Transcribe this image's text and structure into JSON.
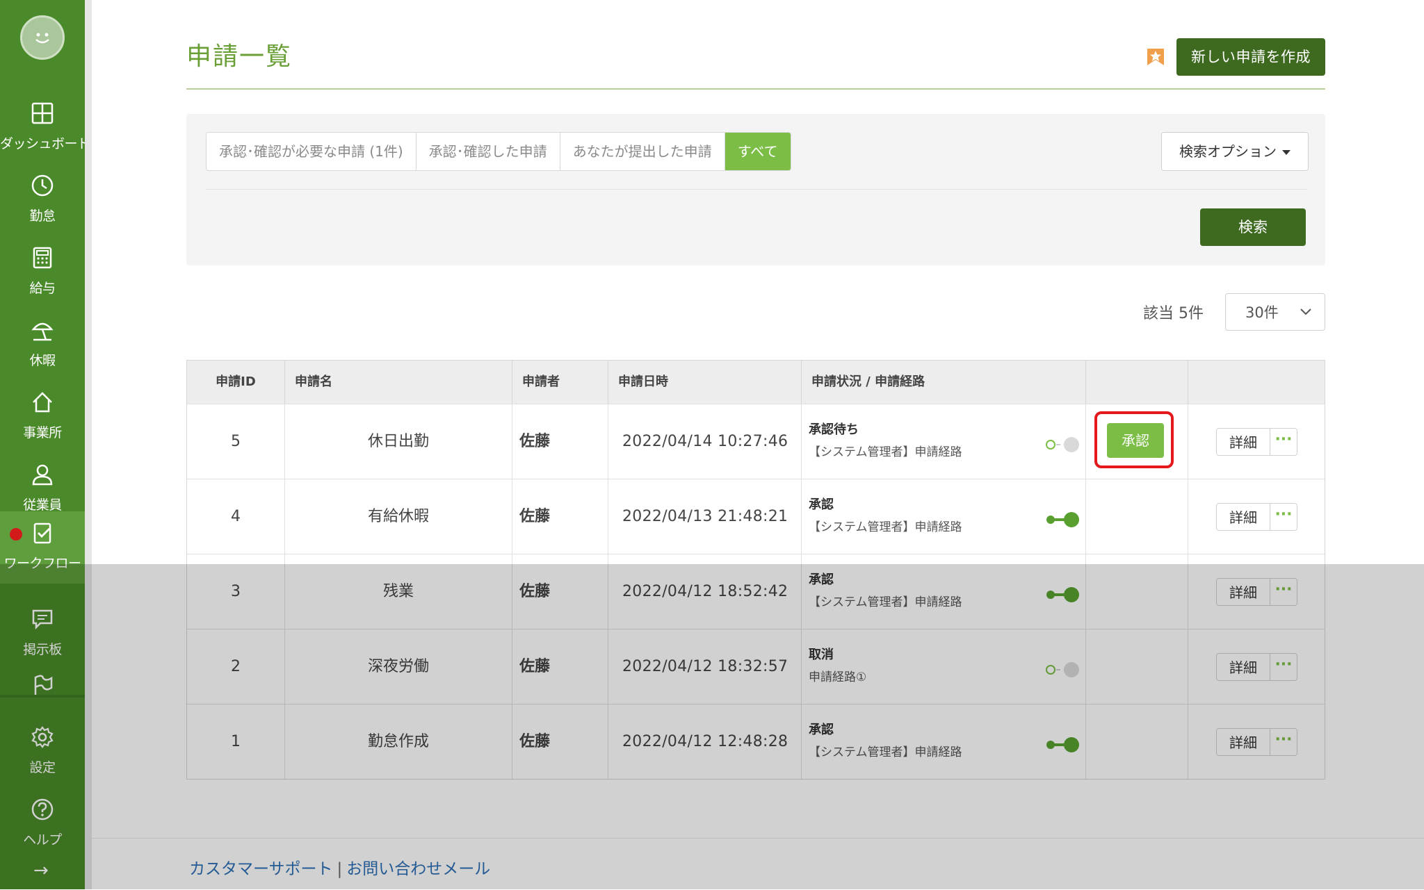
{
  "sidebar": {
    "items": [
      {
        "label": "ダッシュボード",
        "icon": "dashboard-icon"
      },
      {
        "label": "勤怠",
        "icon": "clock-icon"
      },
      {
        "label": "給与",
        "icon": "calculator-icon"
      },
      {
        "label": "休暇",
        "icon": "beach-umbrella-icon"
      },
      {
        "label": "事業所",
        "icon": "home-icon"
      },
      {
        "label": "従業員",
        "icon": "user-icon"
      },
      {
        "label": "ワークフロー",
        "icon": "clipboard-check-icon",
        "active": true
      },
      {
        "label": "掲示板",
        "icon": "message-icon"
      },
      {
        "label": "",
        "icon": "flag-icon"
      },
      {
        "label": "設定",
        "icon": "gear-icon"
      },
      {
        "label": "ヘルプ",
        "icon": "help-icon"
      }
    ],
    "collapse_arrow": "→"
  },
  "header": {
    "title": "申請一覧",
    "new_button": "新しい申請を作成"
  },
  "filters": {
    "tabs": [
      "承認･確認が必要な申請 (1件)",
      "承認･確認した申請",
      "あなたが提出した申請",
      "すべて"
    ],
    "active_tab": "すべて",
    "search_option": "検索オプション",
    "search_button": "検索"
  },
  "results": {
    "count_label": "該当 5件",
    "per_page": "30件"
  },
  "table": {
    "headers": [
      "申請ID",
      "申請名",
      "申請者",
      "申請日時",
      "申請状況 / 申請経路",
      "",
      ""
    ],
    "rows": [
      {
        "id": "5",
        "name": "休日出勤",
        "applicant": "佐藤",
        "datetime": "2022/04/14 10:27:46",
        "status": "承認待ち",
        "route": "【システム管理者】申請経路",
        "progress": "pending",
        "approve": "承認",
        "detail": "詳細"
      },
      {
        "id": "4",
        "name": "有給休暇",
        "applicant": "佐藤",
        "datetime": "2022/04/13 21:48:21",
        "status": "承認",
        "route": "【システム管理者】申請経路",
        "progress": "done",
        "approve": "",
        "detail": "詳細"
      },
      {
        "id": "3",
        "name": "残業",
        "applicant": "佐藤",
        "datetime": "2022/04/12 18:52:42",
        "status": "承認",
        "route": "【システム管理者】申請経路",
        "progress": "done",
        "approve": "",
        "detail": "詳細"
      },
      {
        "id": "2",
        "name": "深夜労働",
        "applicant": "佐藤",
        "datetime": "2022/04/12 18:32:57",
        "status": "取消",
        "route": "申請経路①",
        "progress": "pending",
        "approve": "",
        "detail": "詳細"
      },
      {
        "id": "1",
        "name": "勤怠作成",
        "applicant": "佐藤",
        "datetime": "2022/04/12 12:48:28",
        "status": "承認",
        "route": "【システム管理者】申請経路",
        "progress": "done",
        "approve": "",
        "detail": "詳細"
      }
    ]
  },
  "footer": {
    "support": "カスタマーサポート",
    "separator": "|",
    "contact": "お問い合わせメール"
  },
  "colors": {
    "sidebar": "#4a8a2a",
    "accent": "#7bbd45",
    "dark_button": "#3e6a20",
    "highlight": "#e5191b"
  }
}
